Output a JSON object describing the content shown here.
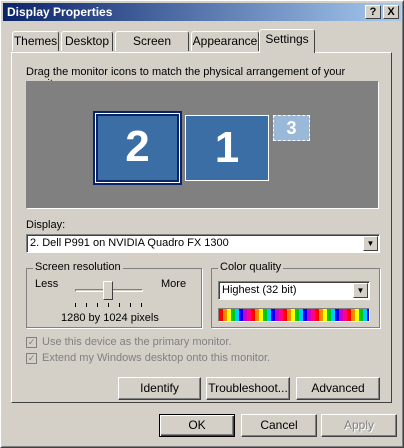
{
  "window": {
    "title": "Display Properties"
  },
  "titlebar": {
    "help_label": "?",
    "close_label": "X"
  },
  "tabs": [
    {
      "label": "Themes"
    },
    {
      "label": "Desktop"
    },
    {
      "label": "Screen Saver"
    },
    {
      "label": "Appearance"
    },
    {
      "label": "Settings"
    }
  ],
  "active_tab": "Settings",
  "instructions": "Drag the monitor icons to match the physical arrangement of your monitors.",
  "monitors": [
    {
      "number": "2",
      "selected": true
    },
    {
      "number": "1",
      "selected": false
    },
    {
      "number": "3",
      "selected": false
    }
  ],
  "display": {
    "label": "Display:",
    "value": "2. Dell P991 on NVIDIA Quadro FX 1300"
  },
  "resolution": {
    "group_label": "Screen resolution",
    "less_label": "Less",
    "more_label": "More",
    "value_text": "1280 by 1024 pixels",
    "slider_fraction": 0.5
  },
  "color_quality": {
    "group_label": "Color quality",
    "value": "Highest (32 bit)"
  },
  "checkboxes": {
    "primary": {
      "label": "Use this device as the primary monitor.",
      "checked": true,
      "disabled": true
    },
    "extend": {
      "label": "Extend my Windows desktop onto this monitor.",
      "checked": true,
      "disabled": true
    }
  },
  "buttons": {
    "identify": "Identify",
    "troubleshoot": "Troubleshoot...",
    "advanced": "Advanced",
    "ok": "OK",
    "cancel": "Cancel",
    "apply": "Apply"
  }
}
